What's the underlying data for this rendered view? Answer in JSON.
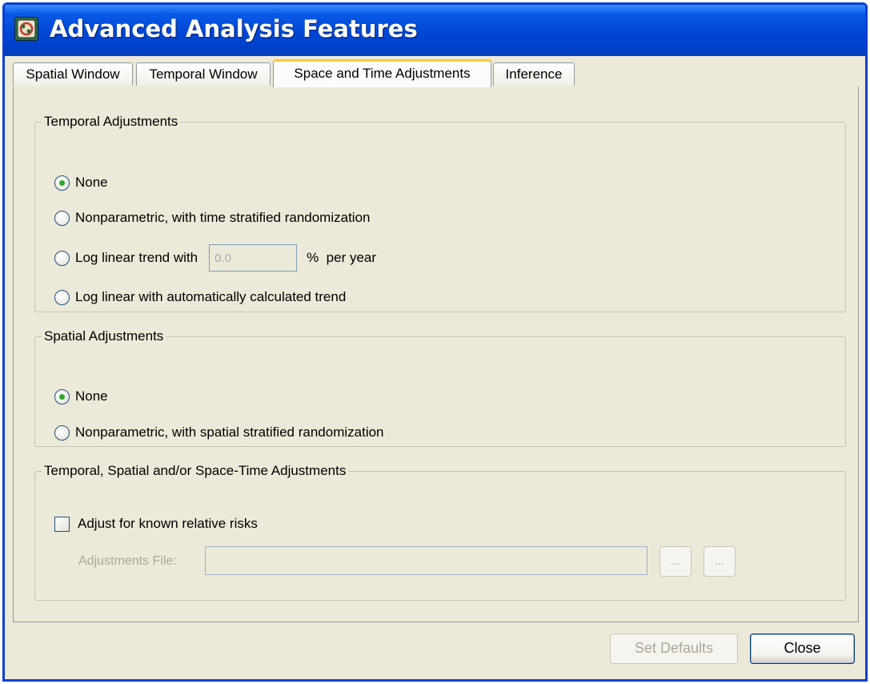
{
  "window": {
    "title": "Advanced Analysis Features",
    "icon": "app-icon"
  },
  "tabs": [
    {
      "label": "Spatial Window",
      "active": false
    },
    {
      "label": "Temporal Window",
      "active": false
    },
    {
      "label": "Space and Time Adjustments",
      "active": true
    },
    {
      "label": "Inference",
      "active": false
    }
  ],
  "temporal_adjustments": {
    "legend": "Temporal Adjustments",
    "options": [
      {
        "label": "None",
        "checked": true
      },
      {
        "label": "Nonparametric, with time stratified randomization",
        "checked": false
      },
      {
        "label": "Log linear trend with",
        "checked": false
      },
      {
        "label": "Log linear with automatically calculated trend",
        "checked": false
      }
    ],
    "trend_value": "0.0",
    "trend_unit": "%  per year"
  },
  "spatial_adjustments": {
    "legend": "Spatial Adjustments",
    "options": [
      {
        "label": "None",
        "checked": true
      },
      {
        "label": "Nonparametric, with spatial stratified randomization",
        "checked": false
      }
    ]
  },
  "space_time_adjustments": {
    "legend": "Temporal, Spatial and/or Space-Time Adjustments",
    "checkbox_label": "Adjust for known relative risks",
    "checked": false,
    "file_label": "Adjustments File:",
    "file_value": "",
    "browse_label_1": "...",
    "browse_label_2": "..."
  },
  "footer": {
    "set_defaults_label": "Set Defaults",
    "close_label": "Close"
  },
  "colors": {
    "titlebar": "#0046d5",
    "dialog_bg": "#ece9d8",
    "active_tab_accent": "#ffc83c",
    "radio_dot": "#2ea52e"
  }
}
